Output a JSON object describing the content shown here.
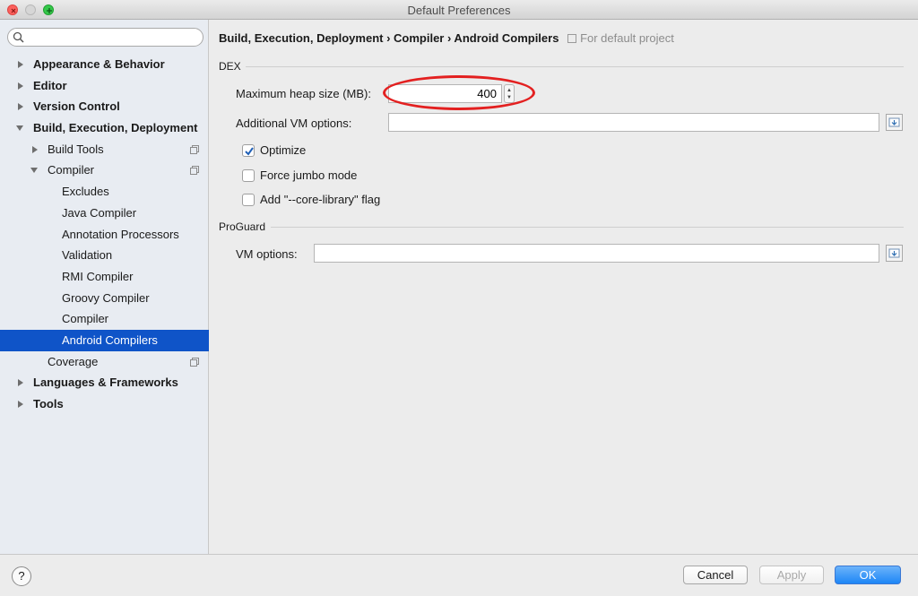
{
  "window": {
    "title": "Default Preferences"
  },
  "search": {
    "placeholder": "",
    "value": ""
  },
  "sidebar": {
    "items": [
      {
        "label": "Appearance & Behavior"
      },
      {
        "label": "Editor"
      },
      {
        "label": "Version Control"
      },
      {
        "label": "Build, Execution, Deployment"
      },
      {
        "label": "Build Tools"
      },
      {
        "label": "Compiler"
      },
      {
        "label": "Excludes"
      },
      {
        "label": "Java Compiler"
      },
      {
        "label": "Annotation Processors"
      },
      {
        "label": "Validation"
      },
      {
        "label": "RMI Compiler"
      },
      {
        "label": "Groovy Compiler"
      },
      {
        "label": "Compiler"
      },
      {
        "label": "Android Compilers"
      },
      {
        "label": "Coverage"
      },
      {
        "label": "Languages & Frameworks"
      },
      {
        "label": "Tools"
      }
    ]
  },
  "main": {
    "breadcrumb": "Build, Execution, Deployment › Compiler › Android Compilers",
    "scope": "For default project",
    "dex": {
      "section": "DEX",
      "heap_label": "Maximum heap size (MB):",
      "heap_value": "400",
      "vm_label": "Additional VM options:",
      "vm_value": "",
      "optimize_label": "Optimize",
      "optimize_checked": true,
      "jumbo_label": "Force jumbo mode",
      "jumbo_checked": false,
      "corelib_label": "Add \"--core-library\" flag",
      "corelib_checked": false
    },
    "proguard": {
      "section": "ProGuard",
      "vm_label": "VM options:",
      "vm_value": ""
    }
  },
  "footer": {
    "help_label": "?",
    "cancel_label": "Cancel",
    "apply_label": "Apply",
    "ok_label": "OK"
  },
  "colors": {
    "selection": "#0f54c8",
    "highlight_oval": "#e32020",
    "primary_button": "#1d86f6"
  }
}
